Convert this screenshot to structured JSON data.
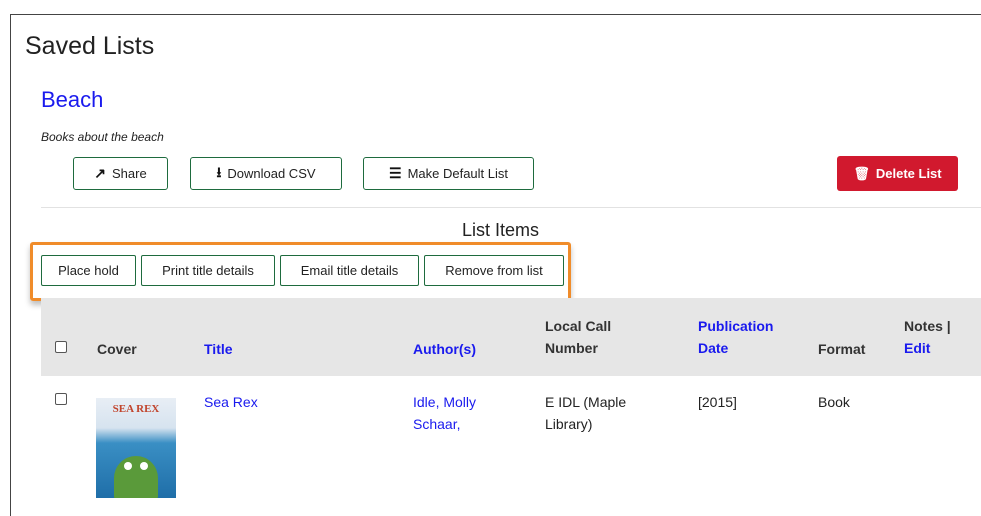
{
  "page": {
    "title": "Saved Lists"
  },
  "list": {
    "name": "Beach",
    "description": "Books about the beach"
  },
  "toolbar": {
    "share_label": "Share",
    "download_label": "Download CSV",
    "default_label": "Make Default List",
    "delete_label": "Delete List",
    "icons": {
      "share": "share-icon",
      "download": "file-download-icon",
      "default": "list-icon",
      "delete": "trash-icon"
    }
  },
  "items_section": {
    "heading": "List Items",
    "actions": [
      "Place hold",
      "Print title details",
      "Email title details",
      "Remove from list"
    ]
  },
  "table": {
    "headers": {
      "cover": "Cover",
      "title": "Title",
      "authors": "Author(s)",
      "call_number_1": "Local Call",
      "call_number_2": "Number",
      "pub_date_1": "Publication",
      "pub_date_2": "Date",
      "format": "Format",
      "notes": "Notes |",
      "edit": "Edit"
    },
    "rows": [
      {
        "cover_text": "SEA REX",
        "title": "Sea Rex",
        "author_1": "Idle, Molly",
        "author_2": "Schaar,",
        "call_1": "E IDL (Maple",
        "call_2": "Library)",
        "pub_date": "[2015]",
        "format": "Book"
      }
    ]
  },
  "colors": {
    "link": "#1a1aee",
    "button_border": "#1e6b3e",
    "danger": "#d1192e",
    "highlight": "#f08c2a",
    "header_bg": "#e6e6e6"
  }
}
